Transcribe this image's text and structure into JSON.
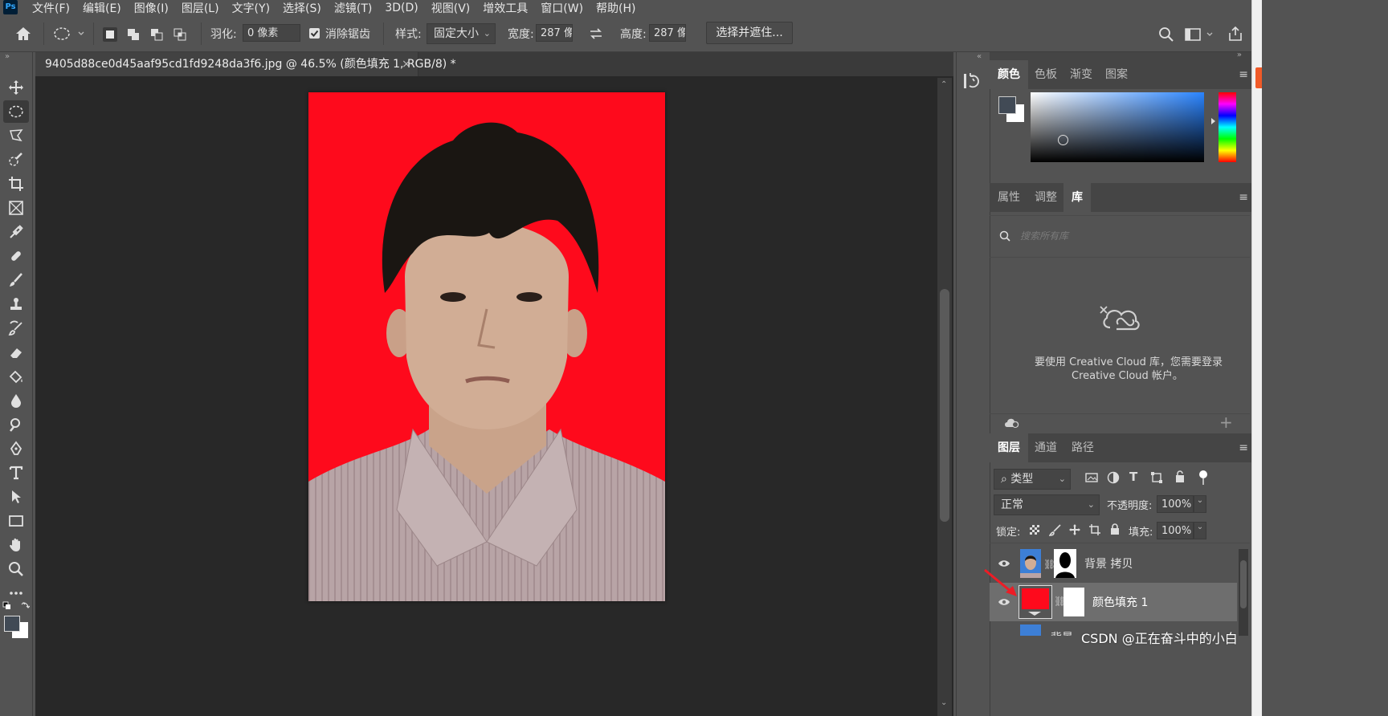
{
  "menubar": {
    "app_icon": "Ps",
    "items": [
      "文件(F)",
      "编辑(E)",
      "图像(I)",
      "图层(L)",
      "文字(Y)",
      "选择(S)",
      "滤镜(T)",
      "3D(D)",
      "视图(V)",
      "增效工具",
      "窗口(W)",
      "帮助(H)"
    ]
  },
  "options": {
    "feather_label": "羽化:",
    "feather_value": "0 像素",
    "antialias_label": "消除锯齿",
    "style_label": "样式:",
    "style_value": "固定大小",
    "width_label": "宽度:",
    "width_value": "287 像",
    "height_label": "高度:",
    "height_value": "287 像",
    "select_mask_button": "选择并遮住..."
  },
  "document": {
    "tab_title": "9405d88ce0d45aaf95cd1fd9248da3f6.jpg @ 46.5% (颜色填充 1, RGB/8) *",
    "tab_close": "×",
    "background_color": "#fe0a1c"
  },
  "color_panel": {
    "tabs": [
      "颜色",
      "色板",
      "渐变",
      "图案"
    ],
    "foreground": "#414a55",
    "background": "#ffffff"
  },
  "library_panel": {
    "tabs": [
      "属性",
      "调整",
      "库"
    ],
    "search_placeholder": "搜索所有库",
    "message_line1": "要使用 Creative Cloud 库，您需要登录",
    "message_line2": "Creative Cloud 帐户。"
  },
  "layers_panel": {
    "tabs": [
      "图层",
      "通道",
      "路径"
    ],
    "filter_value": "类型",
    "blend_mode": "正常",
    "opacity_label": "不透明度:",
    "opacity_value": "100%",
    "lock_label": "锁定:",
    "fill_label": "填充:",
    "fill_value": "100%",
    "layers": [
      {
        "name": "背景 拷贝",
        "visible": true,
        "selected": false
      },
      {
        "name": "颜色填充 1",
        "visible": true,
        "selected": true,
        "thumb_color": "#fe0a1c"
      },
      {
        "name": "背景",
        "visible": true,
        "selected": false
      }
    ]
  },
  "watermark": "CSDN @正在奋斗中的小白"
}
